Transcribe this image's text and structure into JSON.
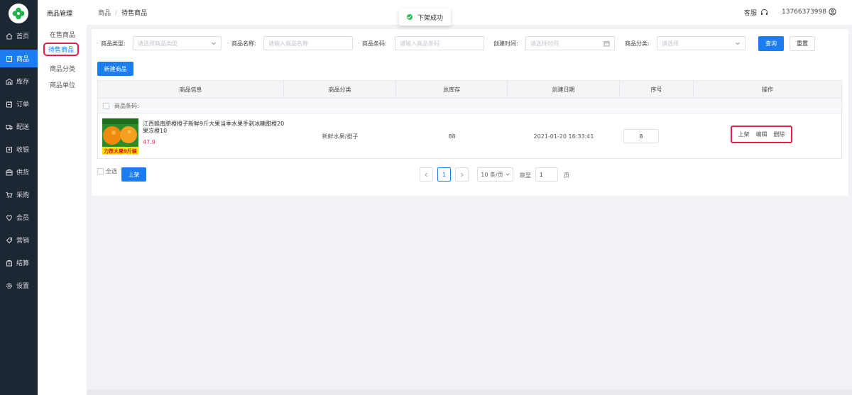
{
  "nav": {
    "items": [
      {
        "label": "首页",
        "icon": "home-icon"
      },
      {
        "label": "商品",
        "icon": "goods-icon",
        "active": true
      },
      {
        "label": "库存",
        "icon": "inventory-icon"
      },
      {
        "label": "订单",
        "icon": "order-icon"
      },
      {
        "label": "配送",
        "icon": "truck-icon"
      },
      {
        "label": "收银",
        "icon": "cashier-icon"
      },
      {
        "label": "供货",
        "icon": "supply-icon"
      },
      {
        "label": "采购",
        "icon": "cart-icon"
      },
      {
        "label": "会员",
        "icon": "member-icon"
      },
      {
        "label": "营销",
        "icon": "marketing-icon"
      },
      {
        "label": "结算",
        "icon": "settlement-icon"
      },
      {
        "label": "设置",
        "icon": "gear-icon"
      }
    ]
  },
  "subnav": {
    "title": "商品管理",
    "items": [
      "在售商品",
      "待售商品",
      "商品分类",
      "商品单位"
    ],
    "active_index": 1
  },
  "header": {
    "breadcrumb": [
      "商品",
      "待售商品"
    ],
    "service_label": "客服",
    "phone": "13766373998"
  },
  "toast": {
    "text": "下架成功"
  },
  "filters": {
    "type_label": "商品类型:",
    "type_placeholder": "请选择商品类型",
    "name_label": "商品名称:",
    "name_placeholder": "请输入商品名称",
    "barcode_label": "商品条码:",
    "barcode_placeholder": "请输入商品条码",
    "time_label": "创建时间:",
    "time_placeholder": "请选择时间",
    "category_label": "商品分类:",
    "category_placeholder": "请选择",
    "query_label": "查询",
    "reset_label": "重置"
  },
  "new_button": "新建商品",
  "table": {
    "headers": [
      "商品信息",
      "商品分类",
      "总库存",
      "创建日期",
      "序号",
      "操作"
    ],
    "group_label": "商品条码:",
    "rows": [
      {
        "name": "江西赣南脐橙橙子新鲜9斤大果当季水果手剥冰糖甜橙20果冻橙10",
        "price": "47.9",
        "category": "新鲜水果/橙子",
        "stock": "88",
        "created": "2021-01-20 16:33:41",
        "seq": "8",
        "ops": [
          "上架",
          "编辑",
          "删除"
        ],
        "image_text": "力荐大果9斤装"
      }
    ]
  },
  "footer": {
    "select_all": "全选",
    "bulk_list": "上架"
  },
  "pagination": {
    "current": "1",
    "page_size": "10 条/页",
    "jump_label": "跳至",
    "jump_value": "1",
    "page_unit": "页"
  },
  "colors": {
    "primary": "#1a7ef2",
    "sidebar": "#1d2633",
    "highlight": "#e11d48",
    "price": "#e7325a",
    "success": "#2cba56"
  }
}
